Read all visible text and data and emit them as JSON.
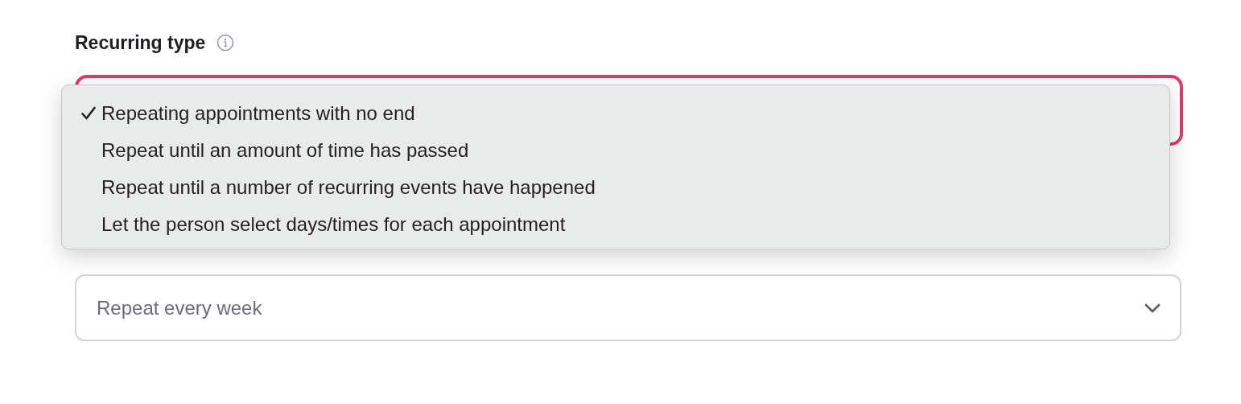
{
  "recurring_type": {
    "label": "Recurring type",
    "menu": [
      {
        "label": "Repeating appointments with no end",
        "selected": true
      },
      {
        "label": "Repeat until an amount of time has passed",
        "selected": false
      },
      {
        "label": "Repeat until a number of recurring events have happened",
        "selected": false
      },
      {
        "label": "Let the person select days/times for each appointment",
        "selected": false
      }
    ]
  },
  "frequency": {
    "value": "Repeat every week"
  }
}
